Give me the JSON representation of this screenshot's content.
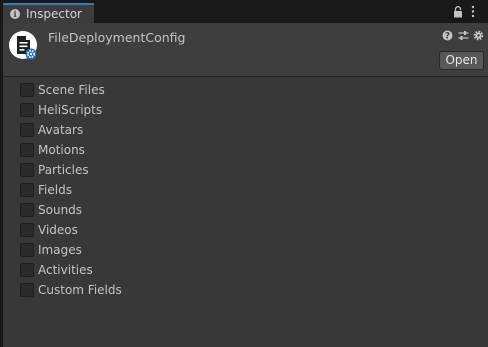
{
  "tab": {
    "label": "Inspector",
    "info_icon": "info-icon",
    "lock_icon": "lock-icon",
    "more_icon": "vertical-dots-icon"
  },
  "header": {
    "title": "FileDeploymentConfig",
    "asset_icon": "scriptable-object-icon",
    "help_icon": "help-icon",
    "settings_icon": "preset-sliders-icon",
    "gear_icon": "gear-icon",
    "open_label": "Open"
  },
  "toggles": [
    {
      "label": "Scene Files",
      "checked": false
    },
    {
      "label": "HeliScripts",
      "checked": false
    },
    {
      "label": "Avatars",
      "checked": false
    },
    {
      "label": "Motions",
      "checked": false
    },
    {
      "label": "Particles",
      "checked": false
    },
    {
      "label": "Fields",
      "checked": false
    },
    {
      "label": "Sounds",
      "checked": false
    },
    {
      "label": "Videos",
      "checked": false
    },
    {
      "label": "Images",
      "checked": false
    },
    {
      "label": "Activities",
      "checked": false
    },
    {
      "label": "Custom Fields",
      "checked": false
    }
  ],
  "colors": {
    "window_bg": "#191919",
    "panel_bg": "#383838",
    "header_bg": "#3e3e3e",
    "tab_accent": "#3a79bb",
    "text": "#c4c4c4"
  }
}
